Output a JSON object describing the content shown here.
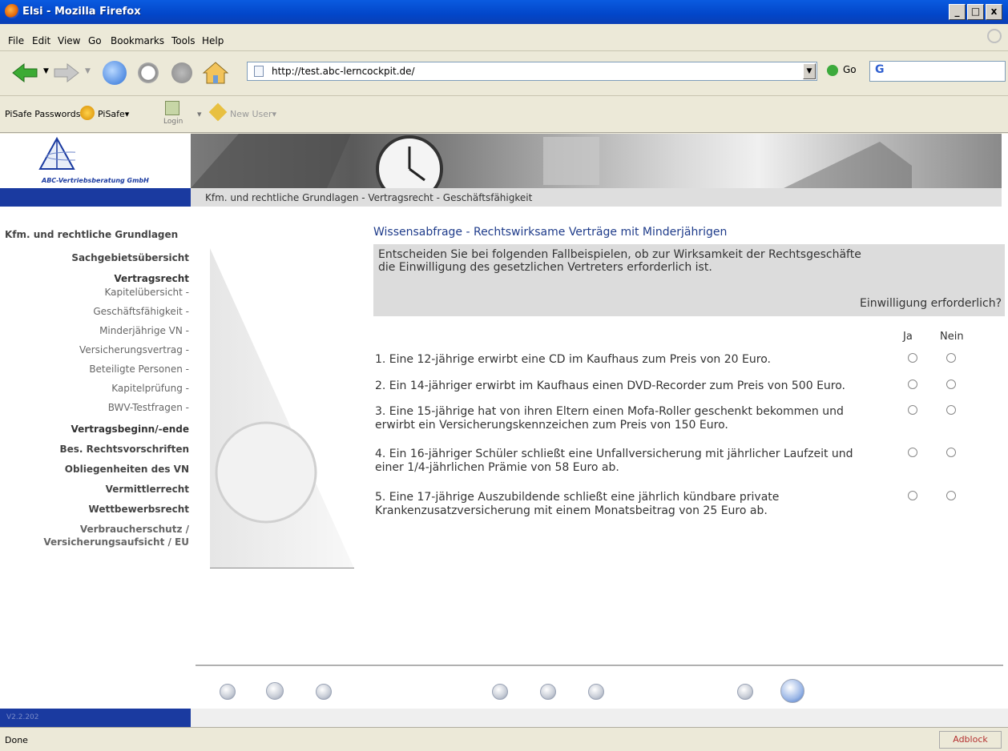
{
  "window": {
    "title": "Elsi - Mozilla Firefox",
    "btn_min": "_",
    "btn_max": "□",
    "btn_close": "x"
  },
  "menu": [
    "File",
    "Edit",
    "View",
    "Go",
    "Bookmarks",
    "Tools",
    "Help"
  ],
  "nav": {
    "url": "http://test.abc-lerncockpit.de/",
    "go_label": "Go",
    "search_value": "G"
  },
  "toolbar": {
    "pisafe_passwords": "PiSafe Passwords",
    "pisafe": "PiSafe▾",
    "login": "Login",
    "new_user": "New User▾"
  },
  "header": {
    "logo_text": "ABC-Vertriebsberatung GmbH",
    "breadcrumb": "Kfm. und rechtliche Grundlagen - Vertragsrecht - Geschäftsfähigkeit"
  },
  "sidebar": {
    "items": [
      "Kfm. und rechtliche Grundlagen",
      "Sachgebietsübersicht",
      "Vertragsrecht",
      "Kapitelübersicht -",
      "Geschäftsfähigkeit -",
      "Minderjährige VN -",
      "Versicherungsvertrag -",
      "Beteiligte Personen -",
      "Kapitelprüfung -",
      "BWV-Testfragen -",
      "Vertragsbeginn/-ende",
      "Bes. Rechtsvorschriften",
      "Obliegenheiten des VN",
      "Vermittlerrecht",
      "Wettbewerbsrecht",
      "Verbraucherschutz /",
      "Versicherungsaufsicht / EU"
    ],
    "version": "V2.2.202"
  },
  "quiz": {
    "title": "Wissensabfrage - Rechtswirksame Verträge mit Minderjährigen",
    "instruction_1": "Entscheiden Sie bei folgenden Fallbeispielen, ob zur Wirksamkeit der Rechtsgeschäfte",
    "instruction_2": "die Einwilligung des gesetzlichen Vertreters erforderlich ist.",
    "question_header": "Einwilligung erforderlich?",
    "col_yes": "Ja",
    "col_no": "Nein",
    "questions": [
      {
        "l1": "1. Eine 12-jährige erwirbt eine CD im Kaufhaus zum Preis von 20 Euro.",
        "l2": ""
      },
      {
        "l1": "2. Ein 14-jähriger erwirbt im Kaufhaus einen DVD-Recorder zum Preis von 500 Euro.",
        "l2": ""
      },
      {
        "l1": "3. Eine 15-jährige hat von ihren Eltern einen Mofa-Roller geschenkt bekommen und",
        "l2": "erwirbt ein Versicherungskennzeichen zum Preis von 150 Euro."
      },
      {
        "l1": "4. Ein 16-jähriger Schüler schließt eine Unfallversicherung mit jährlicher Laufzeit und",
        "l2": "einer 1/4-jährlichen Prämie von 58 Euro ab."
      },
      {
        "l1": "5. Eine 17-jährige Auszubildende schließt eine jährlich kündbare private",
        "l2": "Krankenzusatzversicherung mit einem Monatsbeitrag von 25 Euro ab."
      }
    ]
  },
  "status": {
    "text": "Done",
    "adblock": "Adblock"
  }
}
